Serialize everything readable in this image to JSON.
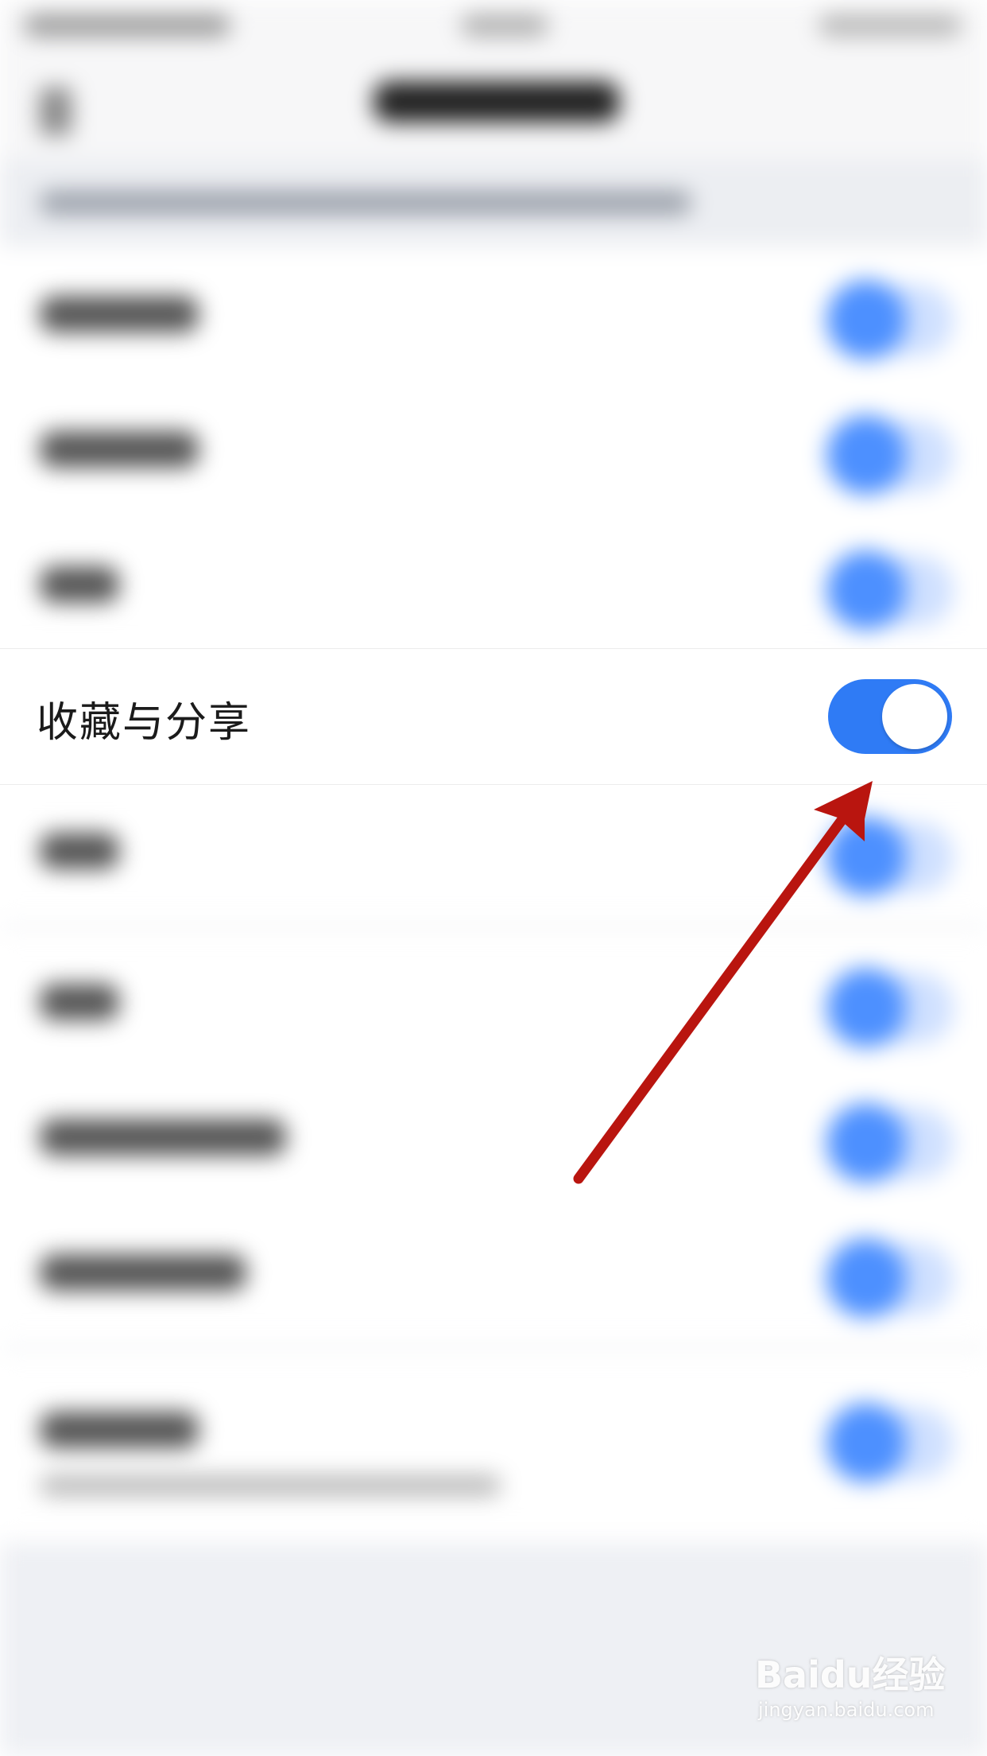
{
  "settings": {
    "highlighted_row": {
      "label": "收藏与分享",
      "toggle_on": true
    }
  },
  "colors": {
    "toggle_on": "#2f7bf5",
    "annotation_arrow": "#b9150f"
  },
  "icons": {
    "annotation": "red-arrow-icon"
  },
  "watermark": {
    "main": "Baidu经验",
    "sub": "jingyan.baidu.com"
  }
}
